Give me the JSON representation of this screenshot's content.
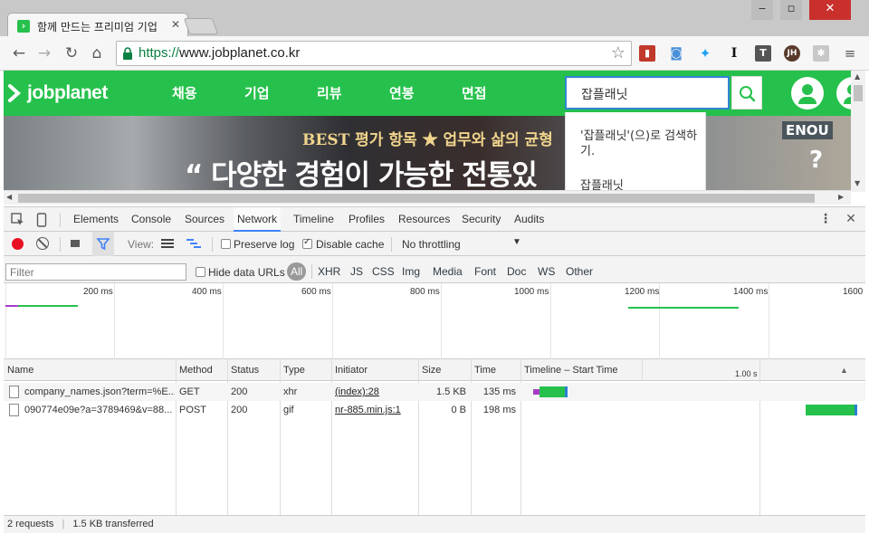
{
  "browser": {
    "tab_title": "함께 만드는 프리미엄 기업",
    "tab_close": "✕",
    "window_controls": {
      "minimize": "‒",
      "maximize": "▫",
      "close": "✕"
    },
    "url_scheme": "https://",
    "url_rest": "www.jobplanet.co.kr",
    "extensions": [
      "bookmark-red-icon",
      "camera-icon",
      "twitter-icon",
      "instapaper-icon",
      "text-t-icon",
      "avatar-jh-icon",
      "extension-gray-icon"
    ],
    "avatar_initials": "JH",
    "instapaper_letter": "I",
    "t_letter": "T"
  },
  "site": {
    "logo_text": "jobplanet",
    "nav": [
      "채용",
      "기업",
      "리뷰",
      "연봉",
      "면접"
    ],
    "search_value": "잡플래닛",
    "suggestions": [
      "'잡플래닛'(으)로 검색하기.",
      "잡플래닛"
    ],
    "banner_sub": "BEST 평가 항목 ★ 업무와 삶의 균형",
    "banner_main": "“ 다양한 경험이 가능한 전통있",
    "banner_side": "ENOU",
    "banner_q": "?"
  },
  "devtools": {
    "tabs": [
      "Elements",
      "Console",
      "Sources",
      "Network",
      "Timeline",
      "Profiles",
      "Resources",
      "Security",
      "Audits"
    ],
    "active_tab": "Network",
    "toolbar": {
      "view_label": "View:",
      "preserve_log": "Preserve log",
      "preserve_log_checked": false,
      "disable_cache": "Disable cache",
      "disable_cache_checked": true,
      "throttling": "No throttling"
    },
    "filter": {
      "placeholder": "Filter",
      "hide_data_urls": "Hide data URLs",
      "types": [
        "All",
        "XHR",
        "JS",
        "CSS",
        "Img",
        "Media",
        "Font",
        "Doc",
        "WS",
        "Other"
      ],
      "active_type": "All"
    },
    "overview_ticks": [
      "200 ms",
      "400 ms",
      "600 ms",
      "800 ms",
      "1000 ms",
      "1200 ms",
      "1400 ms",
      "1600"
    ],
    "columns": [
      "Name",
      "Method",
      "Status",
      "Type",
      "Initiator",
      "Size",
      "Time",
      "Timeline – Start Time"
    ],
    "timeline_marker": "1.00 s",
    "requests": [
      {
        "name": "company_names.json?term=%E...",
        "method": "GET",
        "status": "200",
        "type": "xhr",
        "initiator": "(index):28",
        "size": "1.5 KB",
        "time": "135 ms"
      },
      {
        "name": "090774e09e?a=3789469&v=88...",
        "method": "POST",
        "status": "200",
        "type": "gif",
        "initiator": "nr-885.min.js:1",
        "size": "0 B",
        "time": "198 ms"
      }
    ],
    "status": {
      "requests": "2 requests",
      "separator": "|",
      "transferred": "1.5 KB transferred"
    }
  },
  "colors": {
    "brand_green": "#26c14c",
    "record_red": "#e81123",
    "filter_blue": "#3e82f7"
  }
}
